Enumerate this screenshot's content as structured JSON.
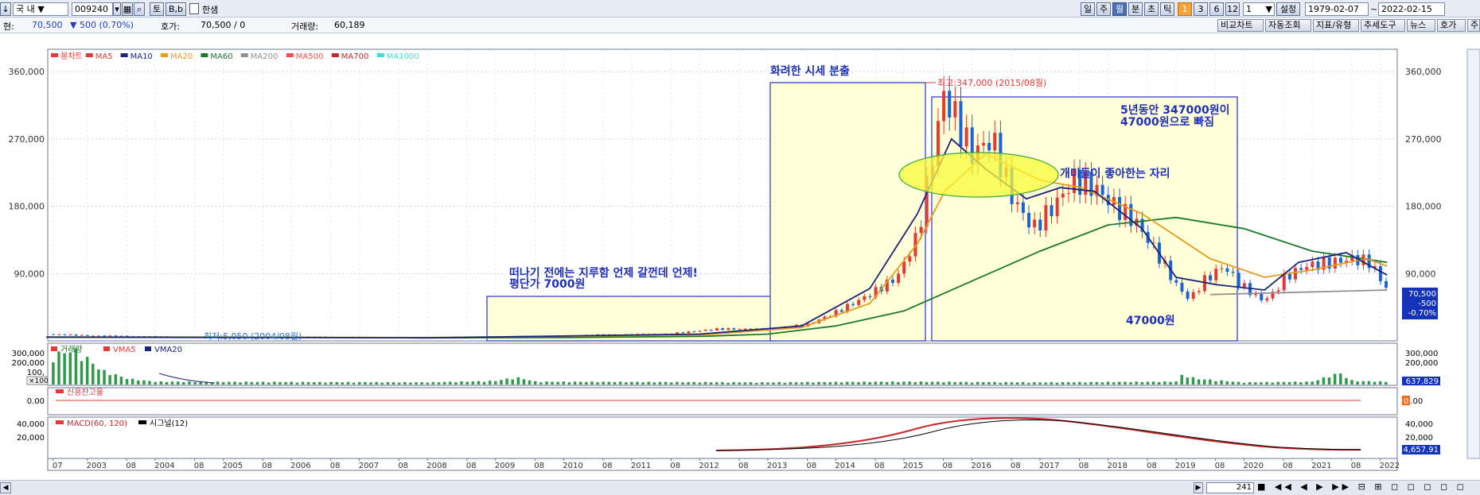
{
  "toolbar": {
    "market": "국 내",
    "code": "009240",
    "btn_to": "토",
    "btn_bb": "B,b",
    "name": "한샘",
    "periods": [
      "일",
      "주",
      "월",
      "분",
      "초",
      "틱"
    ],
    "period_nums": [
      "1",
      "3",
      "6",
      "12"
    ],
    "count": "1",
    "settings": "설정",
    "date_from": "1979-02-07",
    "date_sep": "~",
    "date_to": "2022-02-15"
  },
  "infobar": {
    "price_label": "현:",
    "price": "70,500",
    "change": "▼ 500 (0.70%)",
    "quote_label": "호가:",
    "quote": "70,500 / 0",
    "volume_label": "거래량:",
    "volume": "60,189",
    "right_buttons": [
      "비교차트",
      "자동조회",
      "지표/유형",
      "추세도구",
      "뉴스",
      "호가",
      "주"
    ]
  },
  "legend": [
    {
      "label": "봉차트",
      "color": "#e53935"
    },
    {
      "label": "MA5",
      "color": "#e53935"
    },
    {
      "label": "MA10",
      "color": "#1a237e"
    },
    {
      "label": "MA20",
      "color": "#e69b1e"
    },
    {
      "label": "MA60",
      "color": "#1b7a2a"
    },
    {
      "label": "MA200",
      "color": "#909090"
    },
    {
      "label": "MA500",
      "color": "#ff4d4d"
    },
    {
      "label": "MA700",
      "color": "#c62828"
    },
    {
      "label": "MA1000",
      "color": "#40e0d0"
    }
  ],
  "annotations": {
    "high": "최고:347,000 (2015/08월)",
    "low": "최저:5,050 (2004/08월)",
    "box1_line1": "떠나기 전에는 지루함 언제 갈껀데 언제!",
    "box1_line2": "평단가 7000원",
    "box2": "화려한 시세 분출",
    "box3_line1": "5년동안 347000원이",
    "box3_line2": "47000원으로 빠짐",
    "ellipse": "개미들이 좋아한는 자리",
    "bottom": "47000원"
  },
  "price_box": [
    "70,500",
    "-500",
    "-0.70%"
  ],
  "volume_panel": {
    "legend": [
      "거래량",
      "VMA5",
      "VMA20"
    ],
    "ticks": [
      "300,000",
      "200,000",
      "100,"
    ],
    "unit": "×100",
    "value_box": "637,829"
  },
  "credit_panel": {
    "legend": "신용잔고율",
    "tick": "0.00",
    "value_box": "0"
  },
  "macd_panel": {
    "legend_macd": "MACD(60, 120)",
    "legend_signal": "시그널(12)",
    "ticks": [
      "40,000",
      "20,000"
    ],
    "value_box": "4,657.91"
  },
  "scroll": {
    "count": "241"
  },
  "chart_data": {
    "type": "line",
    "title": "",
    "ylim": [
      0,
      390000
    ],
    "y_ticks": [
      "90,000",
      "180,000",
      "270,000",
      "360,000"
    ],
    "y_tick_values": [
      90000,
      180000,
      270000,
      360000
    ],
    "x_labels": [
      "07",
      "2003",
      "08",
      "2004",
      "08",
      "2005",
      "08",
      "2006",
      "08",
      "2007",
      "08",
      "2008",
      "08",
      "2009",
      "08",
      "2010",
      "08",
      "2011",
      "08",
      "2012",
      "08",
      "2013",
      "08",
      "2014",
      "08",
      "2015",
      "08",
      "2016",
      "08",
      "2017",
      "08",
      "2018",
      "08",
      "2019",
      "08",
      "2020",
      "08",
      "2021",
      "08",
      "2022"
    ],
    "x_label_years": [
      2002.5,
      2003.0,
      2003.58,
      2004.0,
      2004.58,
      2005.0,
      2005.58,
      2006.0,
      2006.58,
      2007.0,
      2007.58,
      2008.0,
      2008.58,
      2009.0,
      2009.58,
      2010.0,
      2010.58,
      2011.0,
      2011.58,
      2012.0,
      2012.58,
      2013.0,
      2013.58,
      2014.0,
      2014.58,
      2015.0,
      2015.58,
      2016.0,
      2016.58,
      2017.0,
      2017.58,
      2018.0,
      2018.58,
      2019.0,
      2019.58,
      2020.0,
      2020.58,
      2021.0,
      2021.58,
      2022.0
    ],
    "series": [
      {
        "name": "MA60",
        "color": "#1b7a2a",
        "x": [
          2002.4,
          2005,
          2008,
          2010,
          2012,
          2013,
          2014,
          2015,
          2016,
          2017,
          2018,
          2019,
          2020,
          2021,
          2022.1
        ],
        "y": [
          5000,
          5000,
          4000,
          4500,
          6000,
          9000,
          20000,
          40000,
          80000,
          120000,
          155000,
          165000,
          150000,
          120000,
          105000
        ]
      },
      {
        "name": "MA20",
        "color": "#e69b1e",
        "x": [
          2002.4,
          2008,
          2012,
          2013.5,
          2014.5,
          2015.2,
          2015.6,
          2016.2,
          2017,
          2017.6,
          2018.5,
          2019.5,
          2020.3,
          2021,
          2021.8,
          2022.1
        ],
        "y": [
          5000,
          4500,
          8000,
          18000,
          50000,
          130000,
          200000,
          250000,
          215000,
          205000,
          170000,
          110000,
          85000,
          95000,
          110000,
          100000
        ]
      },
      {
        "name": "MA10",
        "color": "#1a237e",
        "x": [
          2002.4,
          2008,
          2012,
          2013.5,
          2014.5,
          2015.2,
          2015.7,
          2016.2,
          2016.8,
          2017.3,
          2017.8,
          2018.5,
          2019,
          2019.6,
          2020.3,
          2020.8,
          2021.5,
          2022.1
        ],
        "y": [
          5000,
          4000,
          9000,
          20000,
          70000,
          170000,
          270000,
          230000,
          190000,
          205000,
          200000,
          150000,
          85000,
          75000,
          68000,
          105000,
          118000,
          88000
        ]
      },
      {
        "name": "MA200",
        "color": "#909090",
        "x": [
          2019.5,
          2022.1
        ],
        "y": [
          62000,
          68000
        ]
      }
    ]
  }
}
